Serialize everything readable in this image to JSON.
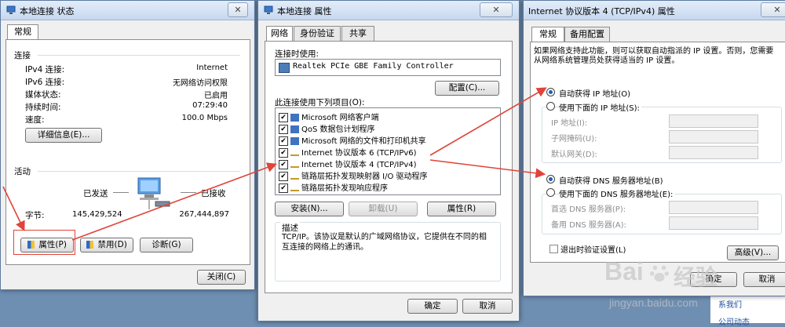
{
  "win1": {
    "title": "本地连接 状态",
    "close_glyph": "✕",
    "tab_general": "常规",
    "section_connection": "连接",
    "rows": [
      {
        "label": "IPv4 连接:",
        "value": "Internet"
      },
      {
        "label": "IPv6 连接:",
        "value": "无网络访问权限"
      },
      {
        "label": "媒体状态:",
        "value": "已启用"
      },
      {
        "label": "持续时间:",
        "value": "07:29:40"
      },
      {
        "label": "速度:",
        "value": "100.0 Mbps"
      }
    ],
    "details_button": "详细信息(E)...",
    "section_activity": "活动",
    "sent_label": "已发送",
    "received_label": "已接收",
    "bytes_label": "字节:",
    "bytes_sent": "145,429,524",
    "bytes_received": "267,444,897",
    "properties_button": "属性(P)",
    "disable_button": "禁用(D)",
    "diagnose_button": "诊断(G)",
    "close_button": "关闭(C)"
  },
  "win2": {
    "title": "本地连接 属性",
    "close_glyph": "✕",
    "tabs": [
      "网络",
      "身份验证",
      "共享"
    ],
    "connect_using_label": "连接时使用:",
    "adapter": "Realtek PCIe GBE Family Controller",
    "configure_button": "配置(C)...",
    "items_label": "此连接使用下列项目(O):",
    "items": [
      "Microsoft 网络客户端",
      "QoS 数据包计划程序",
      "Microsoft 网络的文件和打印机共享",
      "Internet 协议版本 6 (TCP/IPv6)",
      "Internet 协议版本 4 (TCP/IPv4)",
      "链路层拓扑发现映射器 I/O 驱动程序",
      "链路层拓扑发现响应程序"
    ],
    "install_button": "安装(N)...",
    "uninstall_button": "卸载(U)",
    "properties_button": "属性(R)",
    "description_label": "描述",
    "description_text": "TCP/IP。该协议是默认的广域网络协议，它提供在不同的相互连接的网络上的通讯。",
    "ok_button": "确定",
    "cancel_button": "取消"
  },
  "win3": {
    "title": "Internet 协议版本 4 (TCP/IPv4) 属性",
    "close_glyph": "✕",
    "tabs": [
      "常规",
      "备用配置"
    ],
    "intro": "如果网络支持此功能，则可以获取自动指派的 IP 设置。否则，您需要从网络系统管理员处获得适当的 IP 设置。",
    "auto_ip": "自动获得 IP 地址(O)",
    "manual_ip": "使用下面的 IP 地址(S):",
    "ip_address": "IP 地址(I):",
    "subnet_mask": "子网掩码(U):",
    "default_gateway": "默认网关(D):",
    "auto_dns": "自动获得 DNS 服务器地址(B)",
    "manual_dns": "使用下面的 DNS 服务器地址(E):",
    "preferred_dns": "首选 DNS 服务器(P):",
    "alternate_dns": "备用 DNS 服务器(A):",
    "validate_on_exit": "退出时验证设置(L)",
    "advanced_button": "高级(V)...",
    "ok_button": "确定",
    "cancel_button": "取消"
  },
  "watermark": {
    "brand_a": "Bai",
    "brand_b": "经验",
    "url": "jingyan.baidu.com"
  },
  "background_fragments": {
    "link1": "系我们",
    "link2": "公司动态"
  },
  "colors": {
    "annotation_red": "#e0443a",
    "selected_radio": "#1b5ebf"
  }
}
